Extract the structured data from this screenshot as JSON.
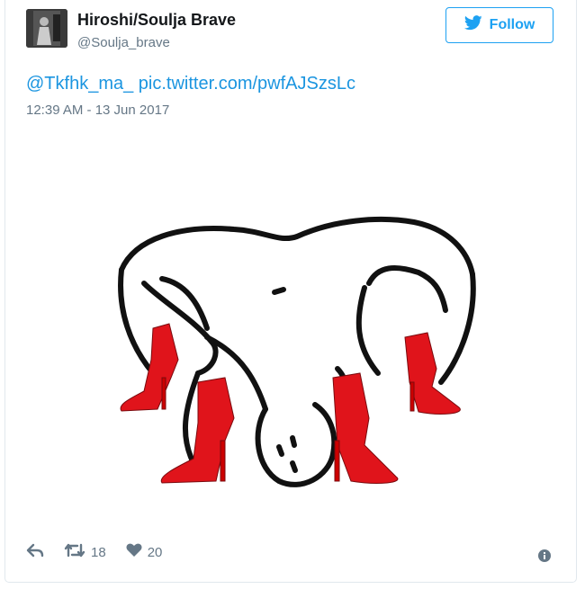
{
  "tweet": {
    "display_name": "Hiroshi/Soulja Brave",
    "handle": "@Soulja_brave",
    "follow_label": "Follow",
    "mention": "@Tkfhk_ma_",
    "link": "pic.twitter.com/pwfAJSzsLc",
    "timestamp": "12:39 AM - 13 Jun 2017",
    "retweet_count": "18",
    "like_count": "20"
  },
  "icons": {
    "follow": "bird-icon",
    "reply": "reply-icon",
    "retweet": "retweet-icon",
    "like": "heart-icon",
    "info": "info-icon"
  },
  "colors": {
    "accent": "#1da1f2",
    "link": "#1b95e0",
    "muted": "#657786",
    "shoe_red": "#e0141b"
  }
}
